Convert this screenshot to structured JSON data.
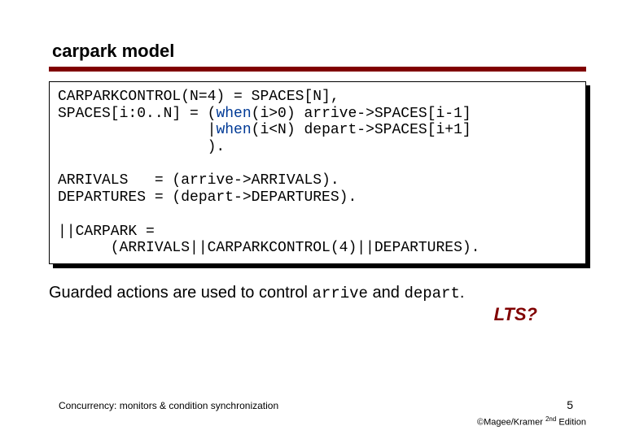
{
  "title": "carpark model",
  "code": {
    "l1a": "CARPARKCONTROL(N=4) = SPACES[N],",
    "l2a": "SPACES[i:0..N] = (",
    "l2_when": "when",
    "l2b": "(i>0) arrive->SPACES[i-1]",
    "l3a": "                 |",
    "l3_when": "when",
    "l3b": "(i<N) depart->SPACES[i+1]",
    "l4": "                 ).",
    "blank1": " ",
    "l5": "ARRIVALS   = (arrive->ARRIVALS).",
    "l6": "DEPARTURES = (depart->DEPARTURES).",
    "blank2": " ",
    "l7": "||CARPARK =",
    "l8": "      (ARRIVALS||CARPARKCONTROL(4)||DEPARTURES)."
  },
  "body": {
    "t1": "Guarded actions are used to control ",
    "c1": "arrive",
    "t2": " and ",
    "c2": "depart",
    "t3": "."
  },
  "lts": "LTS?",
  "footer": {
    "left": "Concurrency: monitors & condition synchronization",
    "page": "5",
    "credit_pre": "©Magee/Kramer ",
    "credit_sup": "2nd",
    "credit_post": " Edition"
  }
}
